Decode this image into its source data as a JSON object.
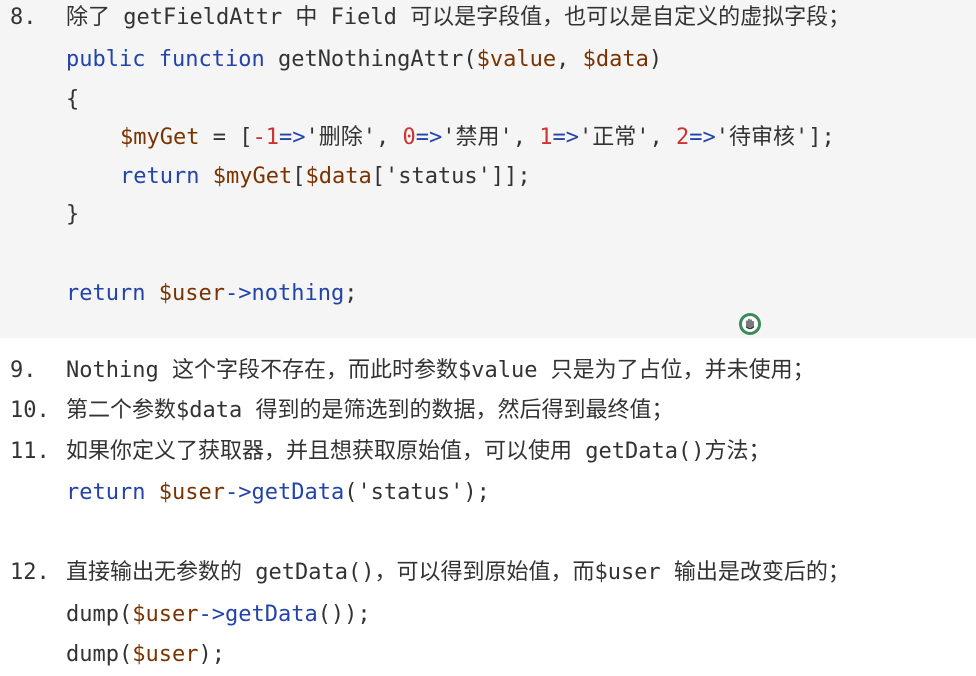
{
  "doc": {
    "item8": {
      "num": "8.",
      "text": "除了 getFieldAttr 中 Field 可以是字段值，也可以是自定义的虚拟字段；",
      "code": {
        "sig_public": "public",
        "sig_function": "function",
        "sig_name": "getNothingAttr(",
        "sig_p1": "$value",
        "sig_comma": ", ",
        "sig_p2": "$data",
        "sig_close": ")",
        "open_brace": "{",
        "myget_var": "$myGet",
        "myget_eq": " = [",
        "k1": "-1",
        "a1": "=>",
        "v1": "'删除'",
        "c1": ", ",
        "k2": "0",
        "a2": "=>",
        "v2": "'禁用'",
        "c2": ", ",
        "k3": "1",
        "a3": "=>",
        "v3": "'正常'",
        "c3": ", ",
        "k4": "2",
        "a4": "=>",
        "v4": "'待审核'",
        "end": "];",
        "ret_kw": "return",
        "ret_var1": "$myGet",
        "ret_b1": "[",
        "ret_var2": "$data",
        "ret_b2": "[",
        "ret_str": "'status'",
        "ret_end": "]];",
        "close_brace": "}",
        "ret2_kw": "return",
        "ret2_var": "$user",
        "ret2_arrow": "->",
        "ret2_prop": "nothing",
        "ret2_end": ";"
      }
    },
    "item9": {
      "num": "9.",
      "text": "Nothing 这个字段不存在，而此时参数$value 只是为了占位，并未使用；"
    },
    "item10": {
      "num": "10.",
      "text": "第二个参数$data 得到的是筛选到的数据，然后得到最终值；"
    },
    "item11": {
      "num": "11.",
      "text": "如果你定义了获取器，并且想获取原始值，可以使用 getData()方法；",
      "code_kw": "return",
      "code_var": "$user",
      "code_arrow": "->",
      "code_fn": "getData",
      "code_open": "(",
      "code_str": "'status'",
      "code_end": ");"
    },
    "item12": {
      "num": "12.",
      "text": "直接输出无参数的 getData()，可以得到原始值，而$user 输出是改变后的；",
      "line1_a": "dump(",
      "line1_var": "$user",
      "line1_arrow": "->",
      "line1_fn": "getData",
      "line1_end": "());",
      "line2_a": "dump(",
      "line2_var": "$user",
      "line2_end": ");"
    }
  },
  "cursor": {
    "icon": "hand-cursor-icon",
    "color": "#3a8a5a"
  }
}
